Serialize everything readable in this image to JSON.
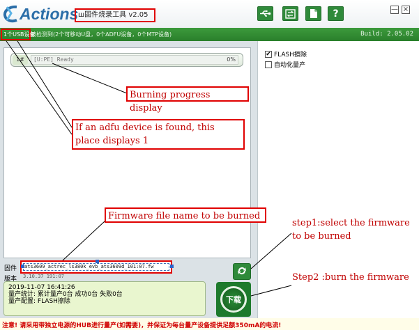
{
  "app": {
    "logo_text": "Actions",
    "title": "ш固件烧录工具 v2.05"
  },
  "toolbar": {
    "buttons": [
      {
        "name": "usb-icon"
      },
      {
        "name": "switch-icon"
      },
      {
        "name": "document-icon"
      },
      {
        "name": "help-icon",
        "label": "?"
      }
    ],
    "minimize_label": "—",
    "close_label": "×"
  },
  "statusbar": {
    "device_count": "1个USB设备",
    "status_text": "被检测到(2个可移动U盘，0个ADFU设备，0个MTP设备)",
    "build": "Build: 2.05.02"
  },
  "options": {
    "flash_erase": {
      "label": "FLASH擦除",
      "checked": true,
      "mark": "✔"
    },
    "auto_production": {
      "label": "自动化量产",
      "checked": false
    }
  },
  "device_list": {
    "rows": [
      {
        "index": "1#",
        "status": "[U:PE] Ready",
        "percent": "0%",
        "progress": 0
      }
    ]
  },
  "firmware": {
    "label": "固件",
    "file": "ats3609_actrec_ls380k_evb_ats3609d_101:07.fw",
    "version_label": "版本",
    "version": "3.10.37 191:07"
  },
  "log": {
    "lines": [
      "2019-11-07  16:41:26",
      "量产统计:  累计量产0台  成功0台  失败0台",
      "量产配置:  FLASH擦除"
    ]
  },
  "burn_button": {
    "label": "下载"
  },
  "footer": {
    "notice": "注意! 请采用带独立电源的HUB进行量产(如需要)，并保证为每台量产设备提供足额350mA的电流!"
  },
  "annotations": {
    "burning_progress": "Burning progress display",
    "adfu_note": "If an adfu device is found, this place displays 1",
    "firmware_name": "Firmware file name to be burned",
    "step1": "step1:select the firmware to be burned",
    "step2": "Step2 :burn the firmware"
  }
}
